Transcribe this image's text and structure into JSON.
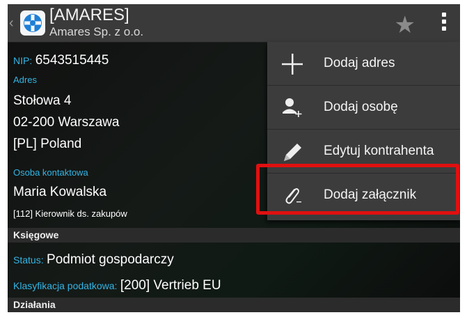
{
  "header": {
    "title": "[AMARES]",
    "subtitle": "Amares Sp. z o.o."
  },
  "details": {
    "nip_label": "NIP:",
    "nip_value": "6543515445",
    "address_label": "Adres",
    "address_line1": "Stołowa 4",
    "address_line2": "02-200 Warszawa",
    "address_line3": "[PL] Poland",
    "contact_label": "Osoba kontaktowa",
    "contact_name": "Maria Kowalska",
    "contact_role": "[112] Kierownik ds. zakupów"
  },
  "sections": {
    "accounting": "Księgowe",
    "actions": "Działania"
  },
  "accounting": {
    "status_label": "Status:",
    "status_value": "Podmiot gospodarczy",
    "tax_label": "Klasyfikacja podatkowa:",
    "tax_value": "[200] Vertrieb EU"
  },
  "menu": {
    "items": [
      {
        "label": "Dodaj adres",
        "icon": "plus-icon"
      },
      {
        "label": "Dodaj osobę",
        "icon": "add-person-icon"
      },
      {
        "label": "Edytuj kontrahenta",
        "icon": "pencil-icon"
      },
      {
        "label": "Dodaj załącznik",
        "icon": "paperclip-icon"
      }
    ]
  },
  "colors": {
    "accent": "#33b5e5",
    "highlight": "#e01010",
    "logo": "#1e7fd6"
  }
}
